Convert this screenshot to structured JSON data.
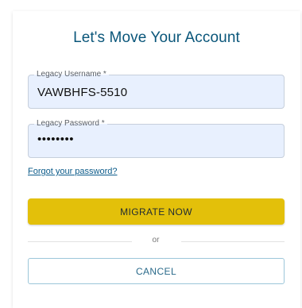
{
  "form": {
    "title": "Let's Move Your Account",
    "username": {
      "label": "Legacy Username *",
      "value": "VAWBHFS-5510"
    },
    "password": {
      "label": "Legacy Password *",
      "value": "••••••••"
    },
    "forgot_link": "Forgot your password?",
    "primary_button": "MIGRATE NOW",
    "divider_text": "or",
    "secondary_button": "CANCEL"
  },
  "colors": {
    "title": "#0a567a",
    "field_background": "#e8f0fe",
    "primary_button": "#e3c00a",
    "secondary_border": "#9cc6d9",
    "link": "#0b5b8a"
  }
}
